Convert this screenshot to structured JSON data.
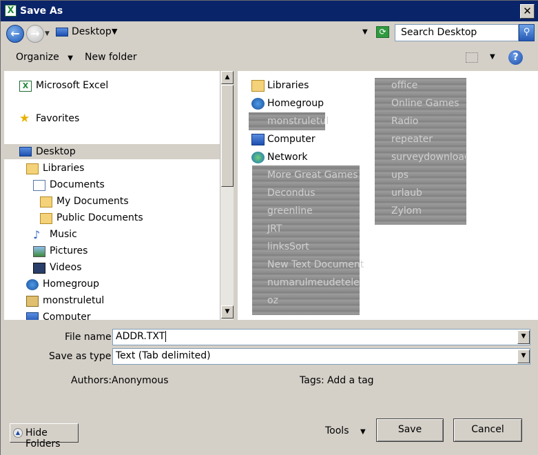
{
  "window": {
    "title": "Save As",
    "close_glyph": "✕"
  },
  "address": {
    "location": "Desktop",
    "search_placeholder": "Search Desktop"
  },
  "toolbar": {
    "organize": "Organize",
    "new_folder": "New folder",
    "help": "?"
  },
  "tree": {
    "items": [
      {
        "label": "Microsoft Excel",
        "icon": "excel-icon"
      },
      {
        "label": "Favorites",
        "icon": "star-icon"
      },
      {
        "label": "Desktop",
        "icon": "desktop-icon",
        "selected": true
      },
      {
        "label": "Libraries",
        "icon": "libraries-icon"
      },
      {
        "label": "Documents",
        "icon": "documents-icon"
      },
      {
        "label": "My Documents",
        "icon": "folder-icon"
      },
      {
        "label": "Public Documents",
        "icon": "folder-icon"
      },
      {
        "label": "Music",
        "icon": "music-icon"
      },
      {
        "label": "Pictures",
        "icon": "pictures-icon"
      },
      {
        "label": "Videos",
        "icon": "videos-icon"
      },
      {
        "label": "Homegroup",
        "icon": "homegroup-icon"
      },
      {
        "label": "monstruletul",
        "icon": "user-icon"
      },
      {
        "label": "Computer",
        "icon": "computer-icon"
      }
    ]
  },
  "files": {
    "column1": [
      {
        "label": "Libraries",
        "icon": "libraries-icon"
      },
      {
        "label": "Homegroup",
        "icon": "homegroup-icon"
      },
      {
        "label": "monstruletul",
        "icon": "user-icon",
        "obscured": true
      },
      {
        "label": "Computer",
        "icon": "computer-icon"
      },
      {
        "label": "Network",
        "icon": "network-icon"
      },
      {
        "label": "More Great Games",
        "icon": "shortcut-icon",
        "obscured": true
      },
      {
        "label": "Decondus",
        "icon": "folder-icon",
        "obscured": true
      },
      {
        "label": "greenline",
        "icon": "folder-icon",
        "obscured": true
      },
      {
        "label": "JRT",
        "icon": "folder-icon",
        "obscured": true
      },
      {
        "label": "linksSort",
        "icon": "folder-icon",
        "obscured": true
      },
      {
        "label": "New Text Document",
        "icon": "file-icon",
        "obscured": true
      },
      {
        "label": "numarulmeudetelefon",
        "icon": "file-icon",
        "obscured": true
      },
      {
        "label": "oz",
        "icon": "folder-icon",
        "obscured": true
      }
    ],
    "column2": [
      {
        "label": "office",
        "icon": "folder-icon",
        "obscured": true
      },
      {
        "label": "Online Games",
        "icon": "shortcut-icon",
        "obscured": true
      },
      {
        "label": "Radio",
        "icon": "folder-icon",
        "obscured": true
      },
      {
        "label": "repeater",
        "icon": "folder-icon",
        "obscured": true
      },
      {
        "label": "surveydownload",
        "icon": "folder-icon",
        "obscured": true
      },
      {
        "label": "ups",
        "icon": "folder-icon",
        "obscured": true
      },
      {
        "label": "urlaub",
        "icon": "folder-icon",
        "obscured": true
      },
      {
        "label": "Zylom",
        "icon": "shortcut-icon",
        "obscured": true
      }
    ]
  },
  "form": {
    "file_name_label": "File name:",
    "file_name_value": "ADDR.TXT",
    "save_type_label": "Save as type:",
    "save_type_value": "Text (Tab delimited)",
    "authors_label": "Authors:",
    "authors_value": "Anonymous",
    "tags_label": "Tags:",
    "tags_value": "Add a tag"
  },
  "buttons": {
    "hide_folders": "Hide Folders",
    "tools": "Tools",
    "save": "Save",
    "cancel": "Cancel"
  },
  "colors": {
    "title_bar": "#0a246a",
    "chrome": "#d4d0c8",
    "selection": "#d4d0c8",
    "obscured": "#8e8e8e"
  }
}
